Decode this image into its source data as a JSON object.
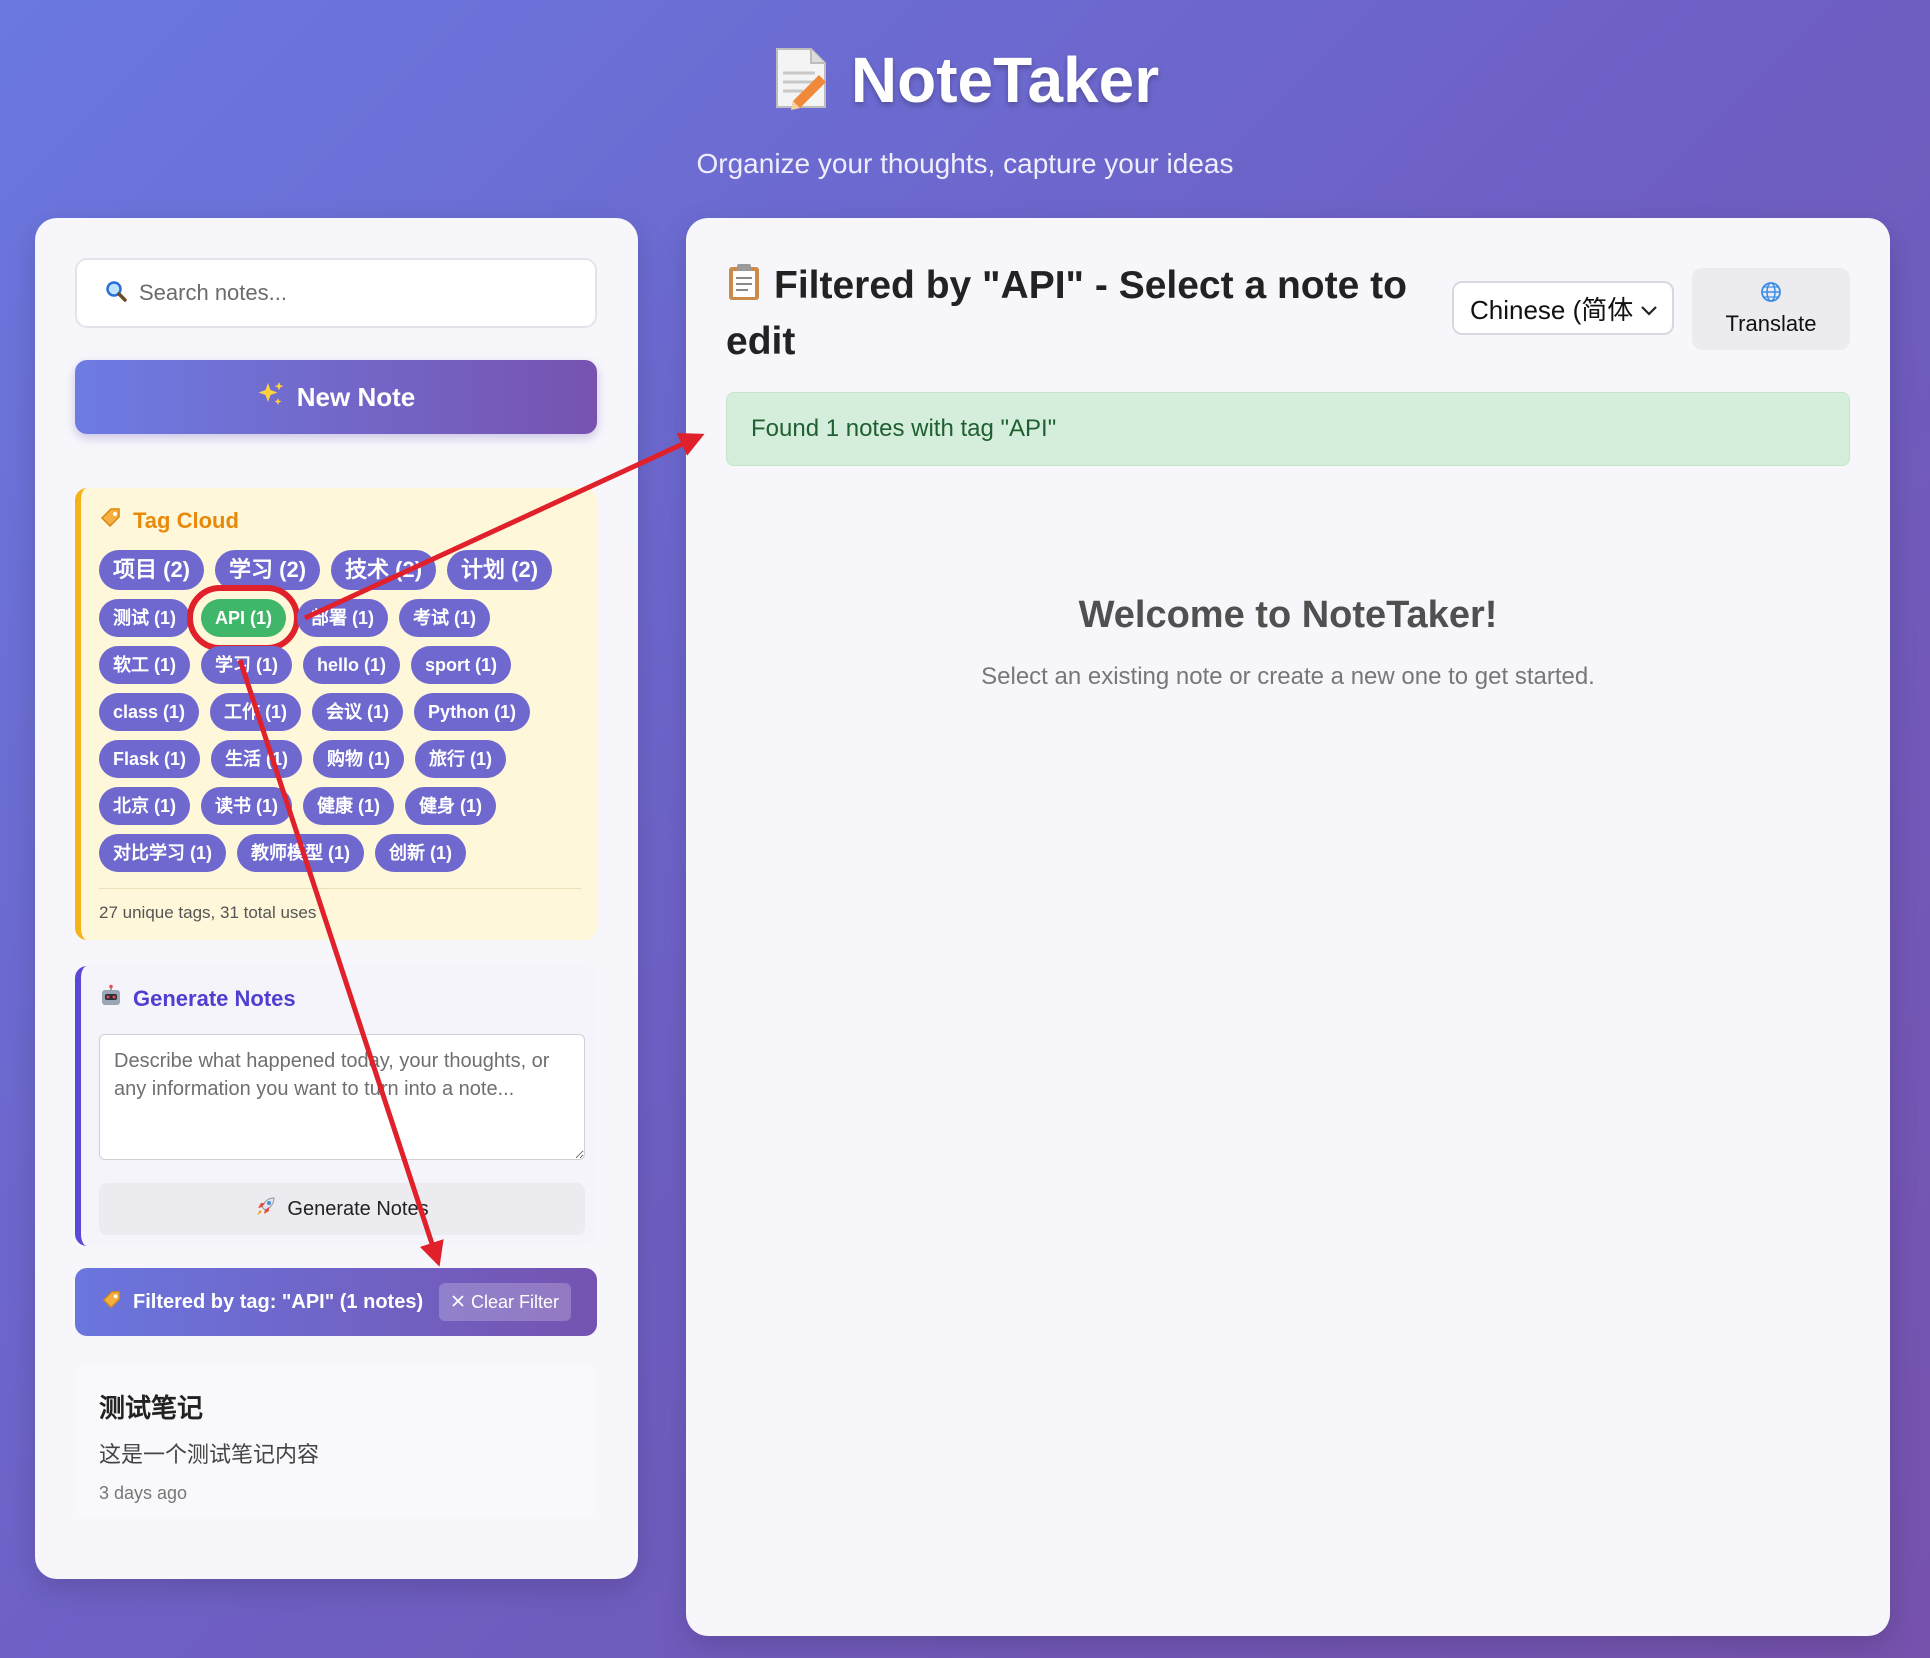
{
  "header": {
    "icon": "memo-icon",
    "title": "NoteTaker",
    "subtitle": "Organize your thoughts, capture your ideas"
  },
  "sidebar": {
    "search": {
      "placeholder": "Search notes...",
      "value": ""
    },
    "new_note_label": "New Note",
    "tag_cloud": {
      "title": "Tag Cloud",
      "tags": [
        {
          "label": "项目 (2)",
          "size": "big"
        },
        {
          "label": "学习 (2)",
          "size": "big"
        },
        {
          "label": "技术 (2)",
          "size": "big"
        },
        {
          "label": "计划 (2)",
          "size": "big"
        },
        {
          "label": "测试 (1)"
        },
        {
          "label": "API (1)",
          "active": true
        },
        {
          "label": "部署 (1)"
        },
        {
          "label": "考试 (1)"
        },
        {
          "label": "软工 (1)"
        },
        {
          "label": "学习 (1)"
        },
        {
          "label": "hello (1)"
        },
        {
          "label": "sport (1)"
        },
        {
          "label": "class (1)"
        },
        {
          "label": "工作 (1)"
        },
        {
          "label": "会议 (1)"
        },
        {
          "label": "Python (1)"
        },
        {
          "label": "Flask (1)"
        },
        {
          "label": "生活 (1)"
        },
        {
          "label": "购物 (1)"
        },
        {
          "label": "旅行 (1)"
        },
        {
          "label": "北京 (1)"
        },
        {
          "label": "读书 (1)"
        },
        {
          "label": "健康 (1)"
        },
        {
          "label": "健身 (1)"
        },
        {
          "label": "对比学习 (1)"
        },
        {
          "label": "教师模型 (1)"
        },
        {
          "label": "创新 (1)"
        }
      ],
      "stats": "27 unique tags, 31 total uses"
    },
    "generate": {
      "title": "Generate Notes",
      "placeholder": "Describe what happened today, your thoughts, or any information you want to turn into a note...",
      "button_label": "Generate Notes"
    },
    "filter": {
      "text": "Filtered by tag: \"API\" (1 notes)",
      "clear_label": "Clear Filter"
    },
    "notes": [
      {
        "title": "测试笔记",
        "preview": "这是一个测试笔记内容",
        "time": "3 days ago"
      }
    ]
  },
  "main": {
    "header_title": "Filtered by \"API\" - Select a note to edit",
    "language": "Chinese (简体",
    "translate_label": "Translate",
    "found_message": "Found 1 notes with tag \"API\"",
    "welcome_title": "Welcome to NoteTaker!",
    "welcome_text": "Select an existing note or create a new one to get started."
  },
  "colors": {
    "tag": "#6e68cf",
    "tag_active": "#3fb66a",
    "annotation": "#e0202a",
    "tag_cloud_accent": "#f5b31b",
    "generate_accent": "#5a49d6"
  }
}
